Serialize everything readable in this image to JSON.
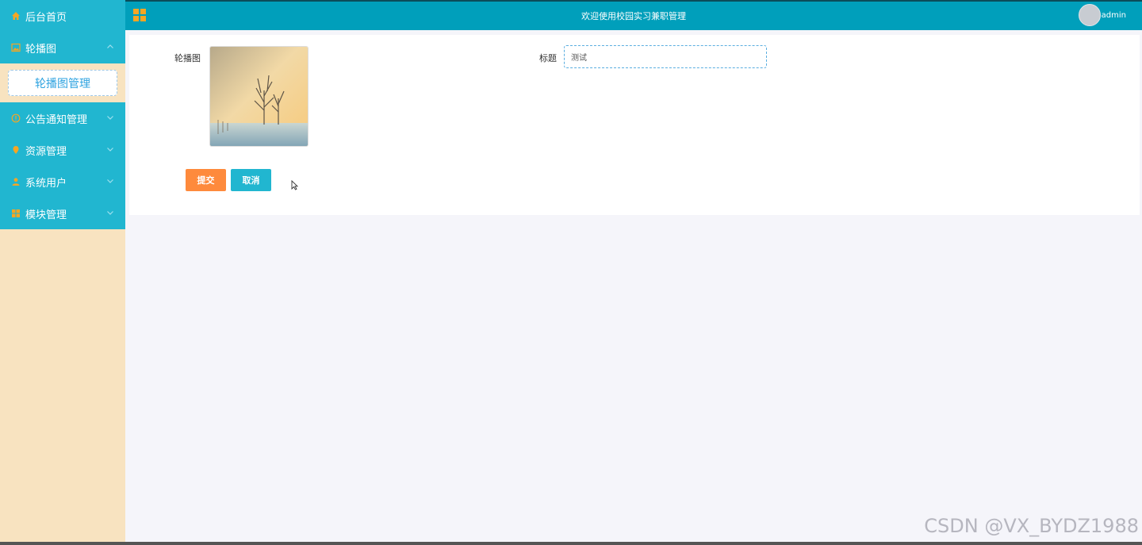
{
  "sidebar": {
    "home": {
      "label": "后台首页",
      "icon": "home-icon"
    },
    "items": [
      {
        "label": "轮播图",
        "icon": "image-icon",
        "expanded": true,
        "children": [
          {
            "label": "轮播图管理"
          }
        ]
      },
      {
        "label": "公告通知管理",
        "icon": "info-icon"
      },
      {
        "label": "资源管理",
        "icon": "location-pin-icon"
      },
      {
        "label": "系统用户",
        "icon": "user-icon"
      },
      {
        "label": "模块管理",
        "icon": "grid-icon"
      }
    ]
  },
  "header": {
    "title": "欢迎使用校园实习兼职管理",
    "username": "admin"
  },
  "form": {
    "image_label": "轮播图",
    "title_label": "标题",
    "title_value": "测试",
    "submit_label": "提交",
    "cancel_label": "取消"
  },
  "watermark": "CSDN @VX_BYDZ1988",
  "colors": {
    "sidebar_menu": "#21b6d0",
    "sidebar_bg": "#f8e3c0",
    "header": "#009fbb",
    "accent_icon": "#f5a623",
    "submit": "#fe8a3c",
    "cancel": "#21b6d0"
  }
}
